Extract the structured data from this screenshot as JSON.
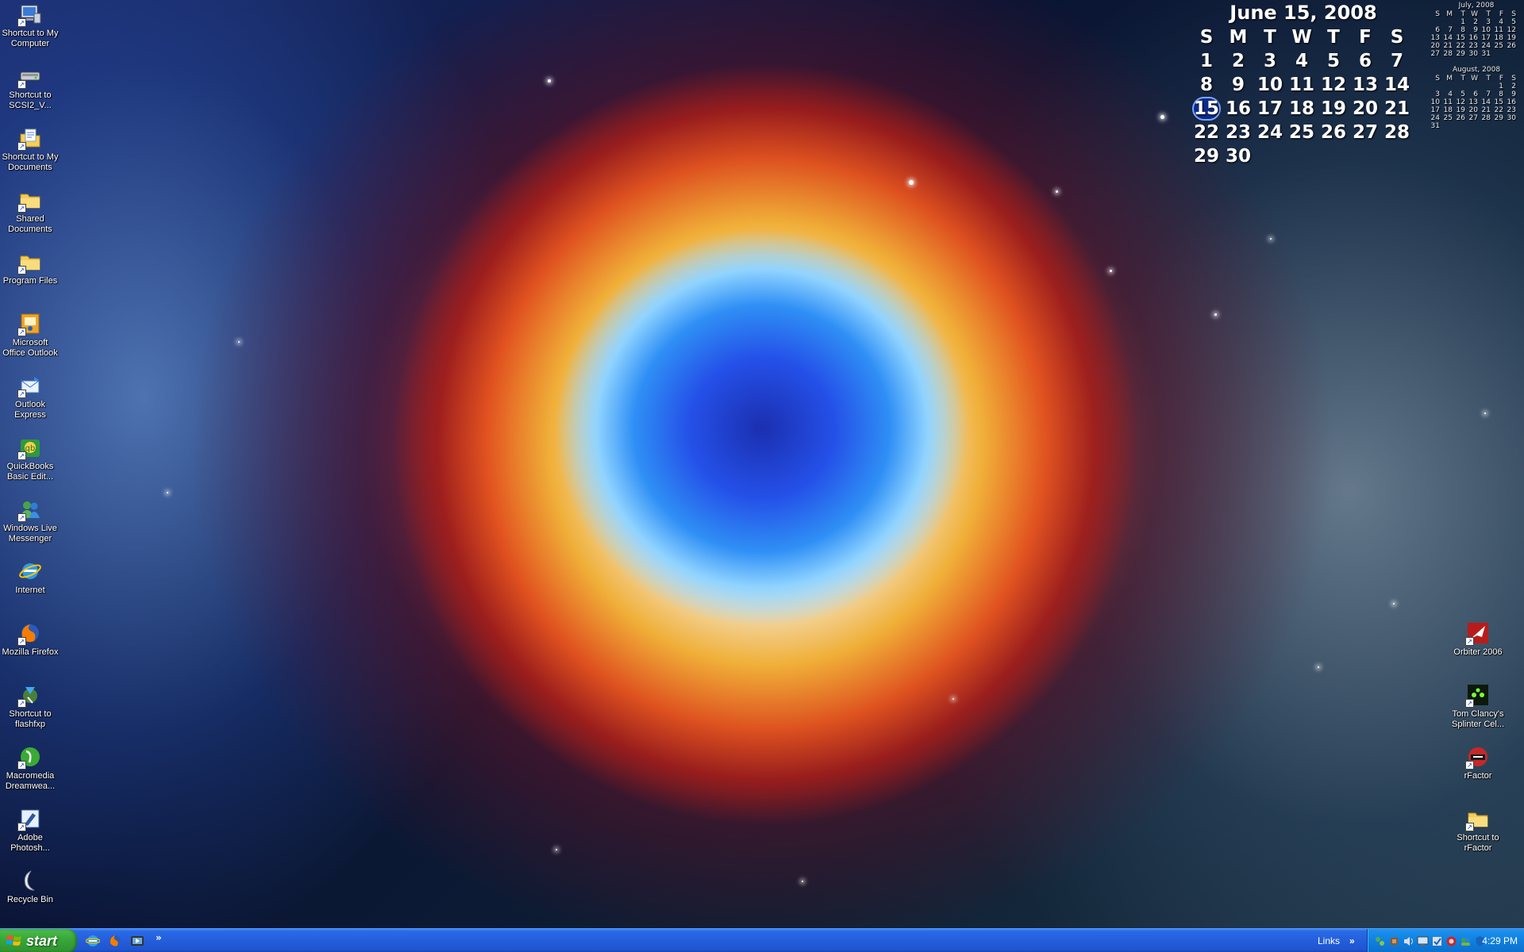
{
  "desktop": {
    "left_icons": [
      {
        "label": "Shortcut to My\nComputer",
        "icon": "my-computer-icon",
        "shortcut": true
      },
      {
        "label": "Shortcut to\nSCSI2_V...",
        "icon": "drive-icon",
        "shortcut": true
      },
      {
        "label": "Shortcut to My\nDocuments",
        "icon": "my-documents-icon",
        "shortcut": true
      },
      {
        "label": "Shared\nDocuments",
        "icon": "folder-icon",
        "shortcut": true
      },
      {
        "label": "Program Files",
        "icon": "folder-icon",
        "shortcut": true
      },
      {
        "label": "Microsoft\nOffice Outlook",
        "icon": "outlook-icon",
        "shortcut": true
      },
      {
        "label": "Outlook\nExpress",
        "icon": "outlook-express-icon",
        "shortcut": true
      },
      {
        "label": "QuickBooks\nBasic Edit...",
        "icon": "quickbooks-icon",
        "shortcut": true
      },
      {
        "label": "Windows Live\nMessenger",
        "icon": "messenger-icon",
        "shortcut": true
      },
      {
        "label": "Internet",
        "icon": "internet-explorer-icon",
        "shortcut": false
      },
      {
        "label": "Mozilla Firefox",
        "icon": "firefox-icon",
        "shortcut": true
      },
      {
        "label": "Shortcut to\nflashfxp",
        "icon": "flashfxp-icon",
        "shortcut": true
      },
      {
        "label": "Macromedia\nDreamwea...",
        "icon": "dreamweaver-icon",
        "shortcut": true
      },
      {
        "label": "Adobe\nPhotosh...",
        "icon": "photoshop-icon",
        "shortcut": true
      },
      {
        "label": "Recycle Bin",
        "icon": "recycle-bin-icon",
        "shortcut": false
      }
    ],
    "right_icons": [
      {
        "label": "Orbiter 2006",
        "icon": "orbiter-icon",
        "shortcut": true
      },
      {
        "label": "Tom Clancy's\nSplinter Cel...",
        "icon": "splinter-cell-icon",
        "shortcut": true
      },
      {
        "label": "rFactor",
        "icon": "rfactor-icon",
        "shortcut": true
      },
      {
        "label": "Shortcut to\nrFactor",
        "icon": "folder-icon",
        "shortcut": true
      }
    ]
  },
  "calendar": {
    "title": "June 15, 2008",
    "weekdays": [
      "S",
      "M",
      "T",
      "W",
      "T",
      "F",
      "S"
    ],
    "first_weekday_index": 0,
    "days_in_month": 30,
    "today": 15
  },
  "mini_calendars": [
    {
      "title": "July, 2008",
      "weekdays": [
        "S",
        "M",
        "T",
        "W",
        "T",
        "F",
        "S"
      ],
      "first_weekday_index": 2,
      "days_in_month": 31
    },
    {
      "title": "August, 2008",
      "weekdays": [
        "S",
        "M",
        "T",
        "W",
        "T",
        "F",
        "S"
      ],
      "first_weekday_index": 5,
      "days_in_month": 31
    }
  ],
  "taskbar": {
    "start_label": "start",
    "quick_launch": [
      "internet-explorer-icon",
      "firefox-icon",
      "media-player-icon"
    ],
    "overflow_chevron": "»",
    "links_label": "Links",
    "links_chevron": "»",
    "tray_icons": [
      "network-icon",
      "volume-icon",
      "speaker-icon",
      "display-icon",
      "update-icon",
      "antivirus-icon",
      "messenger-icon",
      "security-icon"
    ],
    "clock": "4:29 PM"
  },
  "colors": {
    "taskbar_blue": "#245edb",
    "start_green": "#3aa83a",
    "tray_blue": "#0f80e0",
    "calendar_today_bg": "#0d2b8a"
  }
}
